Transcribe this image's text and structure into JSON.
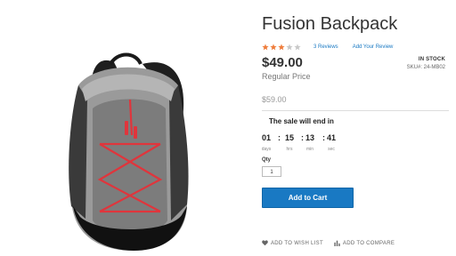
{
  "product": {
    "title": "Fusion Backpack",
    "rating": {
      "stars_filled": 3,
      "stars_total": 5,
      "reviews_link": "3  Reviews",
      "add_review_link": "Add Your Review"
    },
    "price": "$49.00",
    "regular_price_label": "Regular Price",
    "old_price": "$59.00",
    "stock_status": "IN STOCK",
    "sku": "SKU#:  24-MB02"
  },
  "sale": {
    "text": "The sale will end in",
    "countdown": [
      {
        "value": "01",
        "label": "days"
      },
      {
        "value": "15",
        "label": "hrs"
      },
      {
        "value": "13",
        "label": "min"
      },
      {
        "value": "41",
        "label": "sec"
      }
    ]
  },
  "qty": {
    "label": "Qty",
    "value": "1"
  },
  "actions": {
    "add_to_cart": "Add to Cart",
    "wishlist": "ADD TO WISH LIST",
    "compare": "ADD TO COMPARE"
  },
  "colors": {
    "accent": "#1979c3",
    "star_filled": "#ef7d3c",
    "star_empty": "#c8c8c8"
  },
  "icons": {
    "heart": "heart-icon",
    "compare": "compare-icon"
  }
}
